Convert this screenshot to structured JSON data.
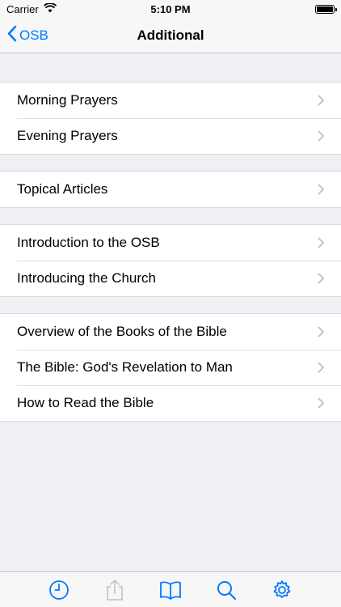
{
  "status_bar": {
    "carrier": "Carrier",
    "time": "5:10 PM"
  },
  "nav": {
    "back_label": "OSB",
    "title": "Additional"
  },
  "sections": [
    {
      "items": [
        "Morning Prayers",
        "Evening Prayers"
      ]
    },
    {
      "items": [
        "Topical Articles"
      ]
    },
    {
      "items": [
        "Introduction to the OSB",
        "Introducing the Church"
      ]
    },
    {
      "items": [
        "Overview of the Books of the Bible",
        "The Bible: God's Revelation to Man",
        "How to Read the Bible"
      ]
    }
  ],
  "tab_bar": {
    "items": [
      {
        "icon": "clock-icon",
        "state": "enabled"
      },
      {
        "icon": "share-icon",
        "state": "disabled"
      },
      {
        "icon": "book-icon",
        "state": "enabled"
      },
      {
        "icon": "search-icon",
        "state": "enabled"
      },
      {
        "icon": "gear-icon",
        "state": "enabled"
      }
    ]
  },
  "colors": {
    "accent": "#007aff",
    "disabled": "#c7c7cc",
    "background": "#efeff4"
  }
}
